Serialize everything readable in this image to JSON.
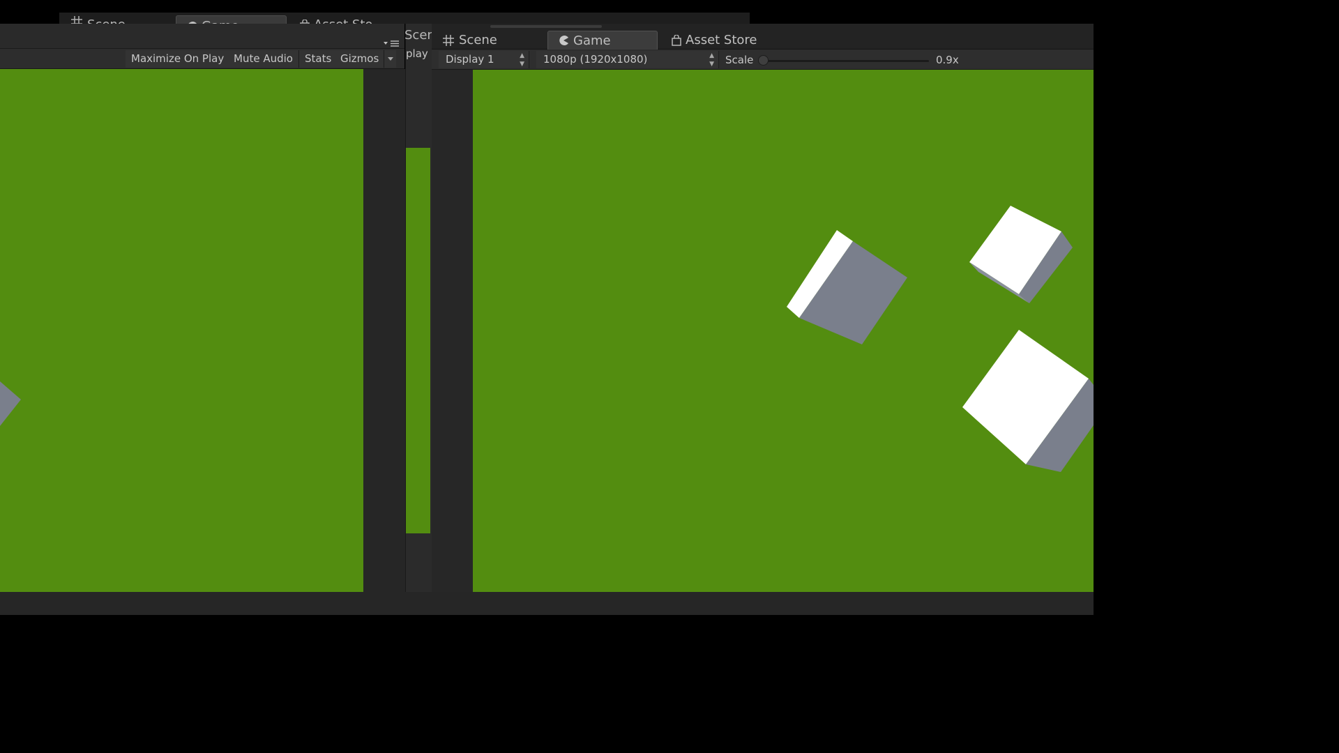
{
  "colors": {
    "game_green": "#538d10",
    "cube_face_light": "#ffffff",
    "cube_face_dark": "#7a7f8c",
    "panel_bg": "#2b2b2b",
    "text": "#c4c4c4"
  },
  "back_window": {
    "tabs": [
      {
        "label": "Scene",
        "icon": "scene-grid-icon",
        "active": false
      },
      {
        "label": "Game",
        "icon": "game-pacman-icon",
        "active": true
      },
      {
        "label": "Asset Sto",
        "icon": "asset-store-bag-icon",
        "active": false
      }
    ]
  },
  "left_panel": {
    "toolbar": {
      "maximize_on_play": "Maximize On Play",
      "mute_audio": "Mute Audio",
      "stats": "Stats",
      "gizmos": "Gizmos"
    }
  },
  "middle_panel": {
    "tab_fragment": "Scen",
    "toolbar_fragment": "play"
  },
  "right_panel": {
    "tabs": [
      {
        "label": "Scene",
        "icon": "scene-grid-icon",
        "active": false
      },
      {
        "label": "Game",
        "icon": "game-pacman-icon",
        "active": true
      },
      {
        "label": "Asset Store",
        "icon": "asset-store-bag-icon",
        "active": false
      }
    ],
    "toolbar": {
      "display_select": "Display 1",
      "resolution_select": "1080p (1920x1080)",
      "scale_label": "Scale",
      "scale_value": "0.9x",
      "scale_fraction": 0.0
    }
  }
}
